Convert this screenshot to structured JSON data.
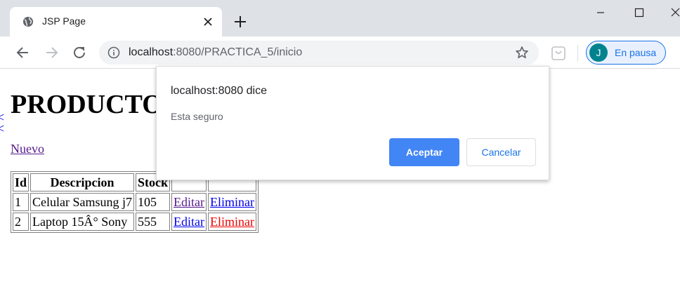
{
  "browser": {
    "tab_title": "JSP Page",
    "url_host": "localhost",
    "url_rest": ":8080/PRACTICA_5/inicio",
    "profile_initial": "J",
    "profile_label": "En pausa",
    "icons": [
      "globe-icon",
      "close-icon",
      "plus-icon",
      "minimize-icon",
      "maximize-icon",
      "window-close-icon",
      "back-arrow-icon",
      "forward-arrow-icon",
      "reload-icon",
      "info-icon",
      "star-icon",
      "extension-icon"
    ]
  },
  "page": {
    "title": "PRODUCTOS",
    "new_link": "Nuevo",
    "table": {
      "headers": [
        "Id",
        "Descripcion",
        "Stock",
        "",
        ""
      ],
      "rows": [
        {
          "id": "1",
          "descripcion": "Celular Samsung j7",
          "stock": "105",
          "edit": "Editar",
          "delete": "Eliminar"
        },
        {
          "id": "2",
          "descripcion": "Laptop 15Â° Sony",
          "stock": "555",
          "edit": "Editar",
          "delete": "Eliminar"
        }
      ]
    }
  },
  "dialog": {
    "title": "localhost:8080 dice",
    "message": "Esta seguro",
    "ok_label": "Aceptar",
    "cancel_label": "Cancelar"
  },
  "colors": {
    "accent": "#4285f4",
    "link": "#0000ee",
    "visited_link": "#551a8b",
    "active_link": "#ee0000",
    "profile_avatar": "#00838f"
  }
}
